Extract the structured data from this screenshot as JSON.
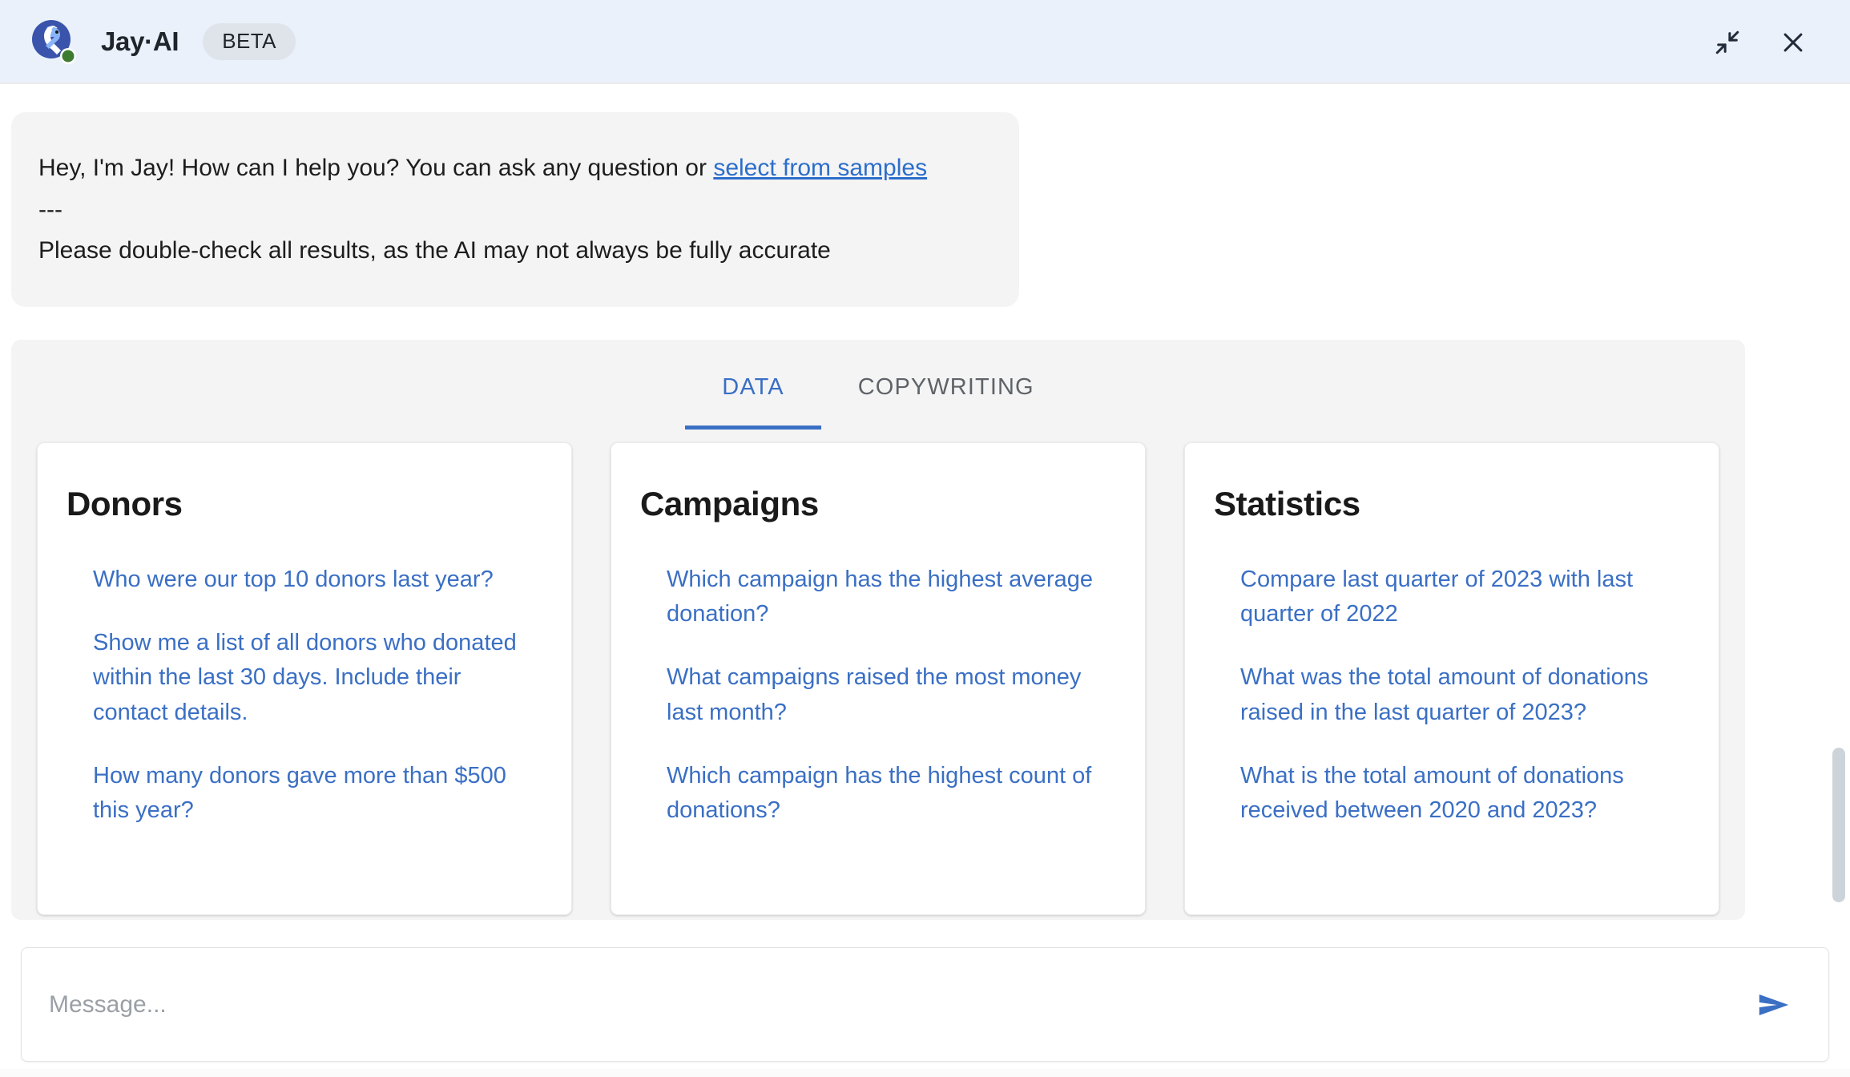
{
  "header": {
    "brand_name": "Jay·AI",
    "badge": "BETA",
    "logo_icon": "jay-bird-logo",
    "status_dot_color": "#3d7b31",
    "logo_circle_color": "#3a54ab",
    "logo_wing_color": "#8ab4f8",
    "background_color": "#eaf1fb",
    "actions": [
      {
        "icon": "collapse-icon",
        "label": "Collapse"
      },
      {
        "icon": "close-icon",
        "label": "Close"
      }
    ]
  },
  "greeting": {
    "line1_before_link": "Hey, I'm Jay! How can I help you? You can ask any question or ",
    "link_text": "select from samples",
    "line2": "---",
    "line3": "Please double-check all results, as the AI may not always be fully accurate",
    "background_color": "#f4f4f4"
  },
  "panel": {
    "background_color": "#f4f4f5",
    "tabs": [
      {
        "label": "DATA",
        "active": true
      },
      {
        "label": "COPYWRITING",
        "active": false
      }
    ],
    "accent_color": "#3a6fc4",
    "cards": [
      {
        "title": "Donors",
        "questions": [
          "Who were our top 10 donors last year?",
          "Show me a list of all donors who donated within the last 30 days. Include their contact details.",
          "How many donors gave more than $500 this year?"
        ]
      },
      {
        "title": "Campaigns",
        "questions": [
          "Which campaign has the highest average donation?",
          "What campaigns raised the most money last month?",
          "Which campaign has the highest count of donations?"
        ]
      },
      {
        "title": "Statistics",
        "questions": [
          "Compare last quarter of 2023 with last quarter of 2022",
          "What was the total amount of donations raised in the last quarter of 2023?",
          "What is the total amount of donations received between 2020 and 2023?"
        ]
      }
    ]
  },
  "composer": {
    "value": "",
    "placeholder": "Message...",
    "send_icon": "send-icon",
    "send_color": "#3a6fc4"
  }
}
